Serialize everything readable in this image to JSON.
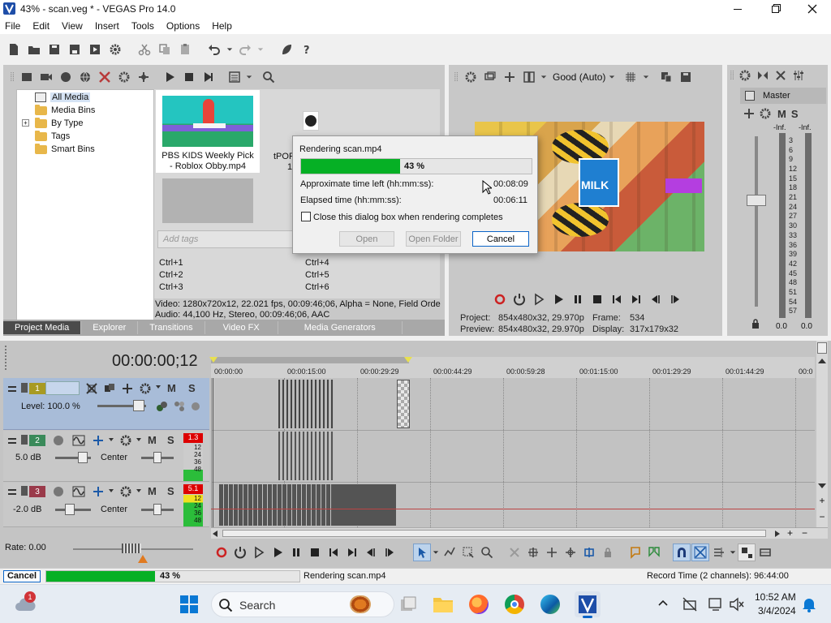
{
  "window": {
    "title": "43% - scan.veg * - VEGAS Pro 14.0"
  },
  "menu": [
    "File",
    "Edit",
    "View",
    "Insert",
    "Tools",
    "Options",
    "Help"
  ],
  "media": {
    "tree": [
      "All Media",
      "Media Bins",
      "By Type",
      "Tags",
      "Smart Bins"
    ],
    "clip1_name": "PBS KIDS Weekly Pick - Roblox Obby.mp4",
    "clip2_name_partial": "tPOR",
    "clip2_line2": "1",
    "tag_placeholder": "Add tags",
    "shortcuts_left": [
      "Ctrl+1",
      "Ctrl+2",
      "Ctrl+3"
    ],
    "shortcuts_right": [
      "Ctrl+4",
      "Ctrl+5",
      "Ctrl+6"
    ],
    "info_video": "Video: 1280x720x12, 22.021 fps, 00:09:46;06, Alpha = None, Field Orde",
    "info_audio": "Audio: 44,100 Hz, Stereo, 00:09:46;06, AAC"
  },
  "tabs": [
    "Project Media",
    "Explorer",
    "Transitions",
    "Video FX",
    "Media Generators"
  ],
  "render_dialog": {
    "title": "Rendering scan.mp4",
    "progress_label": "43 %",
    "progress": 0.43,
    "time_left_label": "Approximate time left (hh:mm:ss):",
    "time_left": "00:08:09",
    "elapsed_label": "Elapsed time (hh:mm:ss):",
    "elapsed": "00:06:11",
    "checkbox_label": "Close this dialog box when rendering completes",
    "open": "Open",
    "open_folder": "Open Folder",
    "cancel": "Cancel"
  },
  "preview": {
    "quality": "Good (Auto)",
    "project_label": "Project:",
    "project": "854x480x32, 29.970p",
    "preview_label": "Preview:",
    "preview": "854x480x32, 29.970p",
    "frame_label": "Frame:",
    "frame": "534",
    "display_label": "Display:",
    "display": "317x179x32",
    "milk_text": "MILK"
  },
  "master": {
    "title": "Master",
    "left_inf": "-Inf.",
    "right_inf": "-Inf.",
    "scale": [
      "3",
      "6",
      "9",
      "12",
      "15",
      "18",
      "21",
      "24",
      "27",
      "30",
      "33",
      "36",
      "39",
      "42",
      "45",
      "48",
      "51",
      "54",
      "57"
    ],
    "left_val": "0.0",
    "right_val": "0.0"
  },
  "timeline": {
    "timecode": "00:00:00;12",
    "ruler": [
      "00:00:00",
      "00:00:15:00",
      "00:00:29:29",
      "00:00:44:29",
      "00:00:59:28",
      "00:01:15:00",
      "00:01:29:29",
      "00:01:44:29",
      "00:0"
    ],
    "tracks": [
      {
        "num": "1",
        "level": "Level: 100.0 %",
        "color": "#a89a22"
      },
      {
        "num": "2",
        "vol": "5.0 dB",
        "pan": "Center",
        "peak": "1.3",
        "color": "#3a8a5a"
      },
      {
        "num": "3",
        "vol": "-2.0 dB",
        "pan": "Center",
        "peak": "5.1",
        "color": "#9a3a4a"
      }
    ],
    "meter_scale": [
      "12",
      "24",
      "36",
      "48"
    ],
    "rate": "Rate: 0.00"
  },
  "status": {
    "cancel": "Cancel",
    "progress_label": "43 %",
    "progress": 0.43,
    "rendering": "Rendering scan.mp4",
    "record_time": "Record Time (2 channels): 96:44:00"
  },
  "taskbar": {
    "search": "Search",
    "time": "10:52 AM",
    "date": "3/4/2024",
    "badge": "1"
  },
  "letters": {
    "m": "M",
    "s": "S"
  }
}
